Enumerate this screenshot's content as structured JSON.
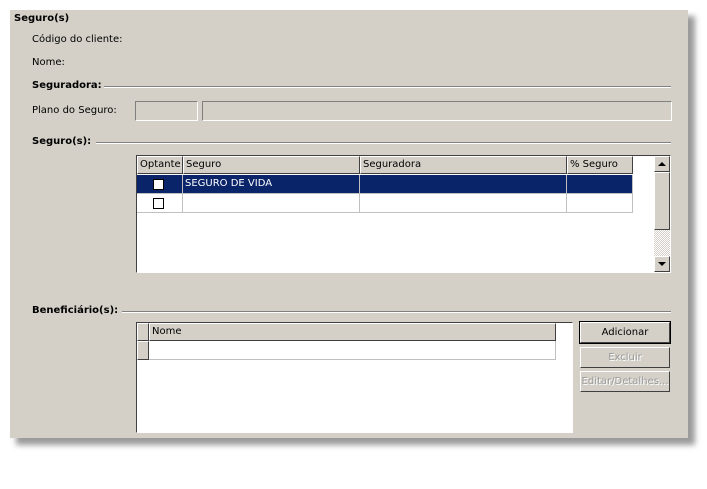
{
  "form": {
    "title": "Seguro(s)",
    "codigo_label": "Código do cliente:",
    "nome_label": "Nome:"
  },
  "seguradora_section": {
    "title": "Seguradora:",
    "plano_label": "Plano do Seguro:",
    "plano_code_value": "",
    "plano_desc_value": ""
  },
  "seguros_section": {
    "title": "Seguro(s):",
    "columns": [
      "Optante",
      "Seguro",
      "Seguradora",
      "% Seguro"
    ],
    "rows": [
      {
        "optante": false,
        "seguro": "SEGURO DE VIDA",
        "seguradora": "",
        "pct": ""
      },
      {
        "optante": false,
        "seguro": "",
        "seguradora": "",
        "pct": ""
      }
    ]
  },
  "beneficiarios_section": {
    "title": "Beneficiário(s):",
    "columns": [
      "Nome"
    ],
    "rows": [
      {
        "nome": ""
      }
    ],
    "buttons": {
      "adicionar": "Adicionar",
      "excluir": "Excluir",
      "editar": "Editar/Detalhes..."
    }
  },
  "colors": {
    "panel": "#d4d0c8",
    "selection": "#0a246a"
  }
}
